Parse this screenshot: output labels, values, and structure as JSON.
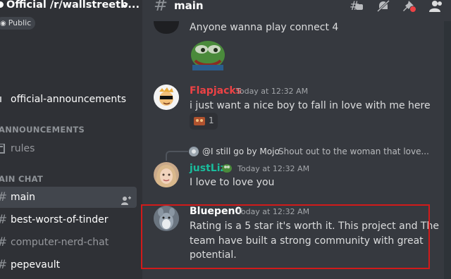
{
  "server": {
    "name": "Official /r/wallstreetb...",
    "public_label": "Public"
  },
  "sidebar": {
    "channels": [
      {
        "label": "official-announcements"
      },
      {
        "category": "ANNOUNCEMENTS"
      },
      {
        "label": "rules"
      },
      {
        "category": "AIN CHAT"
      },
      {
        "label": "main"
      },
      {
        "label": "best-worst-of-tinder"
      },
      {
        "label": "computer-nerd-chat"
      },
      {
        "label": "pepevault"
      }
    ]
  },
  "topbar": {
    "channel": "main"
  },
  "messages": [
    {
      "text": "Anyone wanna play connect 4"
    },
    {
      "author": "Flapjacks",
      "author_color": "#ed4245",
      "timestamp": "Today at 12:32 AM",
      "text": "i just want a nice boy to fall in love with me here",
      "reaction_count": "1"
    },
    {
      "reply_user": "@I still go by Mojo",
      "reply_text": "Shout out to the woman that love...",
      "author": "justLiz",
      "author_color": "#1abc9c",
      "timestamp": "Today at 12:32 AM",
      "text": "I love to love you"
    },
    {
      "author": "Bluepen0",
      "author_color": "#ffffff",
      "timestamp": "Today at 12:32 AM",
      "lines": [
        "Rating is a 5 star it's worth it. This project and The",
        "team have built a strong community with great",
        "potential."
      ]
    }
  ],
  "colors": {
    "highlight": "#d21a1a",
    "sidebar_bg": "#2f3136",
    "chat_bg": "#36393f"
  }
}
